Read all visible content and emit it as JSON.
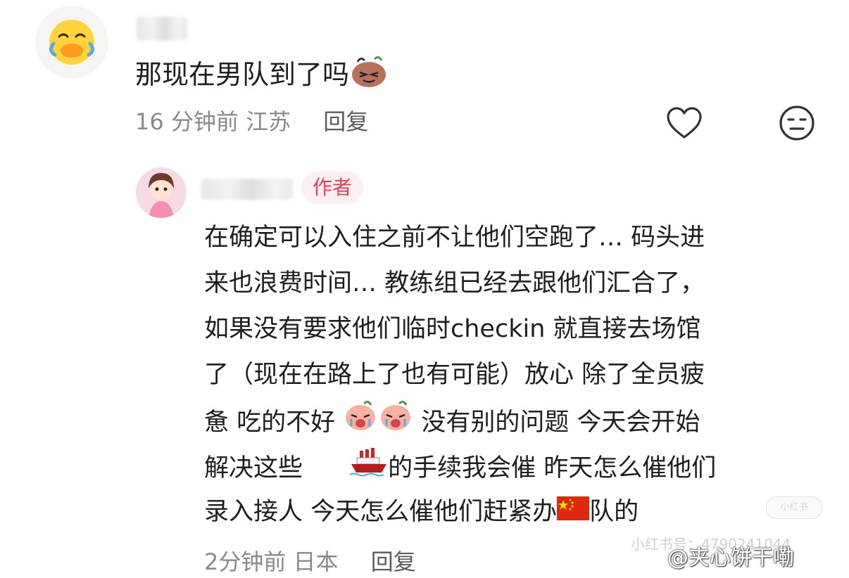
{
  "comment": {
    "text": "那现在男队到了吗",
    "emoji": "smirk-sticker-icon",
    "time": "16 分钟前",
    "location": "江苏",
    "reply_label": "回复"
  },
  "reply": {
    "author_badge": "作者",
    "lines": [
      "在确定可以入住之前不让他们空跑了… 码头进",
      "来也浪费时间…  教练组已经去跟他们汇合了，",
      "如果没有要求他们临时checkin 就直接去场馆",
      "了（现在在路上了也有可能）放心  除了全员疲",
      "惫  吃的不好",
      "没有别的问题   今天会开始",
      "解决这些",
      "的手续我会催  昨天怎么催他们",
      "录入接人 今天怎么催他们赶紧办",
      "队的"
    ],
    "time": "2分钟前",
    "location": "日本",
    "reply_label": "回复"
  },
  "watermark": {
    "badge": "小红书",
    "id": "小红书号：4790241044",
    "weibo": "@夹心饼干嘞"
  },
  "colors": {
    "meta_gray": "#8a8a8a",
    "author_badge_text": "#e2425a",
    "author_badge_bg": "#fdeef1"
  }
}
